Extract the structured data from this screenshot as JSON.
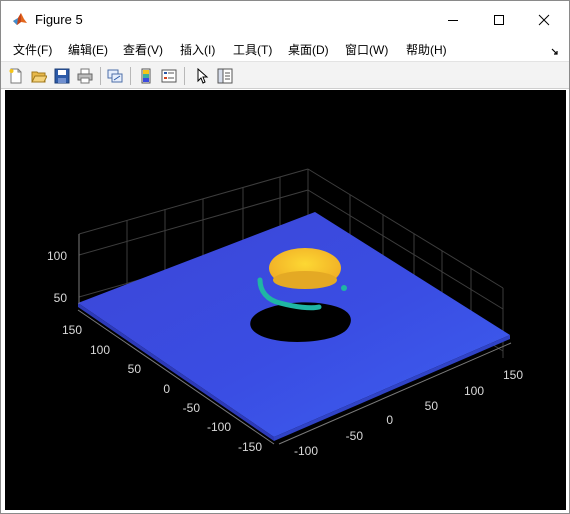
{
  "window": {
    "title": "Figure 5",
    "controls": {
      "minimize": "minimize",
      "maximize": "maximize",
      "close": "close"
    }
  },
  "menubar": {
    "items": [
      {
        "label": "文件(F)"
      },
      {
        "label": "编辑(E)"
      },
      {
        "label": "查看(V)"
      },
      {
        "label": "插入(I)"
      },
      {
        "label": "工具(T)"
      },
      {
        "label": "桌面(D)"
      },
      {
        "label": "窗口(W)"
      },
      {
        "label": "帮助(H)"
      }
    ]
  },
  "toolbar": {
    "buttons": [
      "new-figure-icon",
      "open-file-icon",
      "save-icon",
      "print-icon",
      "link-plot-icon",
      "insert-colorbar-icon",
      "insert-legend-icon",
      "edit-plot-icon",
      "property-inspector-icon"
    ]
  },
  "axes": {
    "z_ticks": [
      "100",
      "50"
    ],
    "y_ticks": [
      "150",
      "100",
      "50",
      "0",
      "-50",
      "-100",
      "-150"
    ],
    "x_ticks": [
      "-100",
      "-50",
      "0",
      "50",
      "100",
      "150"
    ]
  },
  "colors": {
    "background": "#000000",
    "surface": "#3b4ae0",
    "peak": "#fbc81f",
    "ring": "#1fb6a4"
  }
}
